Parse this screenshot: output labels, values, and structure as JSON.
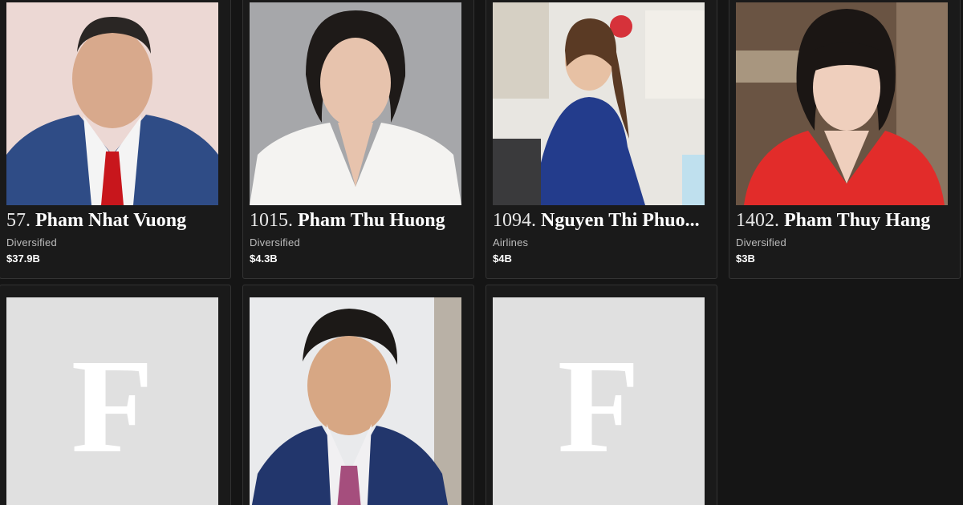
{
  "people": [
    {
      "rank": "57.",
      "name": "Pham Nhat Vuong",
      "industry": "Diversified",
      "worth": "$37.9B",
      "photo": "portrait-man-red-tie"
    },
    {
      "rank": "1015.",
      "name": "Pham Thu Huong",
      "industry": "Diversified",
      "worth": "$4.3B",
      "photo": "portrait-woman-white-blazer"
    },
    {
      "rank": "1094.",
      "name": "Nguyen Thi Phuo...",
      "industry": "Airlines",
      "worth": "$4B",
      "photo": "portrait-woman-blue-dress"
    },
    {
      "rank": "1402.",
      "name": "Pham Thuy Hang",
      "industry": "Diversified",
      "worth": "$3B",
      "photo": "portrait-woman-red-jacket"
    }
  ],
  "second_row": [
    {
      "photo": "forbes-placeholder",
      "letter": "F"
    },
    {
      "photo": "portrait-man-pink-tie"
    },
    {
      "photo": "forbes-placeholder",
      "letter": "F"
    }
  ]
}
